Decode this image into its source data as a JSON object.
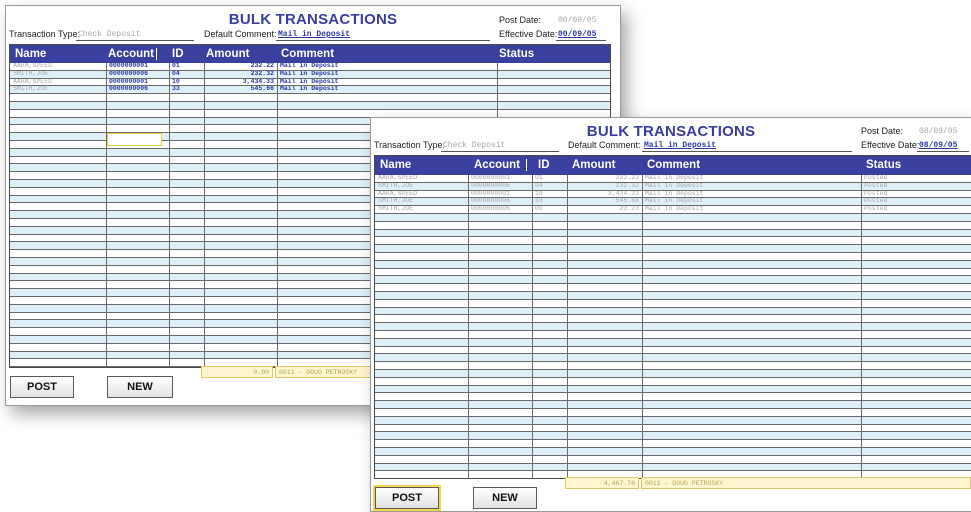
{
  "screens": [
    {
      "title": "BULK TRANSACTIONS",
      "post_date_label": "Post Date:",
      "post_date": "00/09/05",
      "transaction_type_label": "Transaction Type:",
      "transaction_type": "Check Deposit",
      "default_comment_label": "Default Comment:",
      "default_comment": "Mail in Deposit",
      "effective_date_label": "Effective Date:",
      "effective_date": "00/09/05",
      "columns": [
        "Name",
        "Account",
        "ID",
        "Amount",
        "Comment",
        "Status"
      ],
      "rows": [
        {
          "name": "AARA,SPEED",
          "account": "0000000001",
          "id": "01",
          "amount": "232.22",
          "comment": "Mail in Deposit",
          "status": ""
        },
        {
          "name": "SMITH,JOE",
          "account": "0000000006",
          "id": "04",
          "amount": "232.32",
          "comment": "Mail in Deposit",
          "status": ""
        },
        {
          "name": "AARA,SPEED",
          "account": "0000000001",
          "id": "10",
          "amount": "3,434.33",
          "comment": "Mail in Deposit",
          "status": ""
        },
        {
          "name": "SMITH,JOE",
          "account": "0000000006",
          "id": "33",
          "amount": "545.66",
          "comment": "Mail in Deposit",
          "status": ""
        }
      ],
      "total_amount": "0.00",
      "total_user": "0011 - DOUG PETROSKY",
      "post_button": "POST",
      "new_button": "NEW"
    },
    {
      "title": "BULK TRANSACTIONS",
      "post_date_label": "Post Date:",
      "post_date": "08/09/05",
      "transaction_type_label": "Transaction Type:",
      "transaction_type": "Check Deposit",
      "default_comment_label": "Default Comment:",
      "default_comment": "Mail in Deposit",
      "effective_date_label": "Effective Date:",
      "effective_date": "08/09/05",
      "columns": [
        "Name",
        "Account",
        "ID",
        "Amount",
        "Comment",
        "Status"
      ],
      "rows": [
        {
          "name": "AARA,SPEED",
          "account": "0000000001",
          "id": "01",
          "amount": "232.22",
          "comment": "Mail in Deposit",
          "status": "Posted"
        },
        {
          "name": "SMITH,JOE",
          "account": "0000000006",
          "id": "04",
          "amount": "232.32",
          "comment": "Mail in Deposit",
          "status": "Posted"
        },
        {
          "name": "AARA,SPEED",
          "account": "0000000001",
          "id": "10",
          "amount": "3,434.33",
          "comment": "Mail in Deposit",
          "status": "Posted"
        },
        {
          "name": "SMITH,JOE",
          "account": "0000000006",
          "id": "33",
          "amount": "545.66",
          "comment": "Mail in Deposit",
          "status": "Posted"
        },
        {
          "name": "SMITH,JOE",
          "account": "0000000006",
          "id": "00",
          "amount": "23.23",
          "comment": "Mail in Deposit",
          "status": "Posted"
        }
      ],
      "total_amount": "4,467.76",
      "total_user": "0011 - DOUG PETROSKY",
      "post_button": "POST",
      "new_button": "NEW"
    }
  ],
  "colors": {
    "header_bg": "#3b3f9e",
    "title": "#3a3f9e",
    "alt_row": "#dfeff8",
    "totals_bg": "#fff6cf",
    "posted_text": "#a8a8a8",
    "entry_text": "#2d3aa0"
  }
}
